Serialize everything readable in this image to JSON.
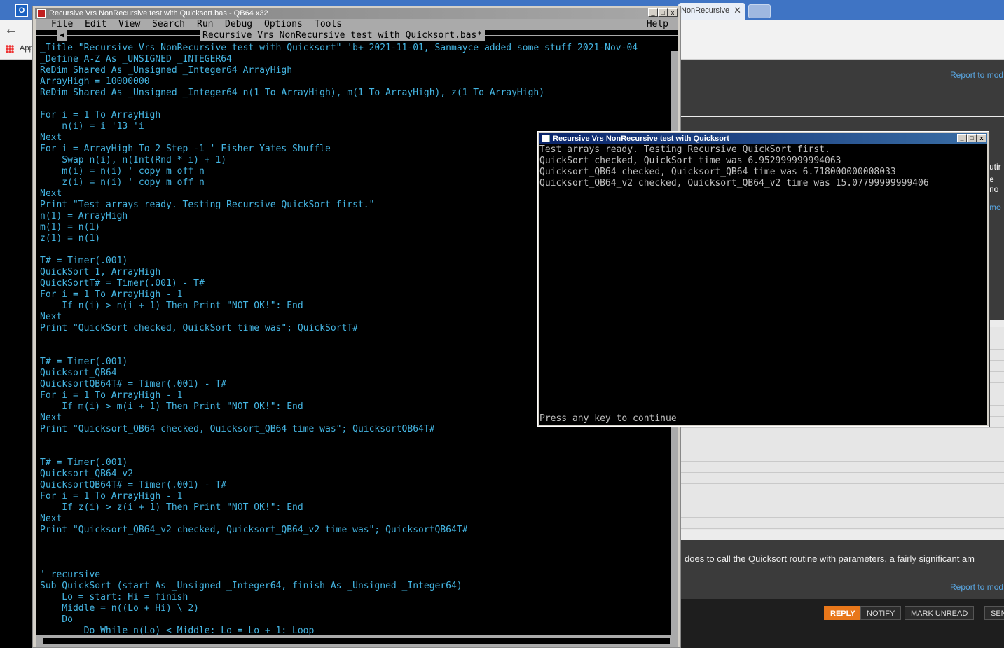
{
  "browser": {
    "tab_label": "NonRecursive",
    "close_glyph": "✕",
    "apps_label": "App",
    "back_glyph": "←",
    "outlook_glyph": "O",
    "page": {
      "report_label": "Report to mod",
      "post_text": "does to call the Quicksort routine with parameters, a fairly significant am",
      "stub1": "utir",
      "stub2": "e no",
      "stub3": "mo",
      "buttons": {
        "reply": "REPLY",
        "notify": "NOTIFY",
        "mark_unread": "MARK UNREAD",
        "send": "SEND T"
      }
    }
  },
  "ide": {
    "title": "Recursive Vrs NonRecursive test with Quicksort.bas - QB64 x32",
    "menu": [
      "File",
      "Edit",
      "View",
      "Search",
      "Run",
      "Debug",
      "Options",
      "Tools"
    ],
    "help_label": "Help",
    "file_title": "Recursive Vrs NonRecursive test with Quicksort.bas*",
    "code": [
      "_Title \"Recursive Vrs NonRecursive test with Quicksort\" 'b+ 2021-11-01, Sanmayce added some stuff 2021-Nov-04",
      "_Define A-Z As _UNSIGNED _INTEGER64",
      "ReDim Shared As _Unsigned _Integer64 ArrayHigh",
      "ArrayHigh = 10000000",
      "ReDim Shared As _Unsigned _Integer64 n(1 To ArrayHigh), m(1 To ArrayHigh), z(1 To ArrayHigh)",
      "",
      "For i = 1 To ArrayHigh",
      "    n(i) = i '13 'i",
      "Next",
      "For i = ArrayHigh To 2 Step -1 ' Fisher Yates Shuffle",
      "    Swap n(i), n(Int(Rnd * i) + 1)",
      "    m(i) = n(i) ' copy m off n",
      "    z(i) = n(i) ' copy m off n",
      "Next",
      "Print \"Test arrays ready. Testing Recursive QuickSort first.\"",
      "n(1) = ArrayHigh",
      "m(1) = n(1)",
      "z(1) = n(1)",
      "",
      "T# = Timer(.001)",
      "QuickSort 1, ArrayHigh",
      "QuickSortT# = Timer(.001) - T#",
      "For i = 1 To ArrayHigh - 1",
      "    If n(i) > n(i + 1) Then Print \"NOT OK!\": End",
      "Next",
      "Print \"QuickSort checked, QuickSort time was\"; QuickSortT#",
      "",
      "",
      "T# = Timer(.001)",
      "Quicksort_QB64",
      "QuicksortQB64T# = Timer(.001) - T#",
      "For i = 1 To ArrayHigh - 1",
      "    If m(i) > m(i + 1) Then Print \"NOT OK!\": End",
      "Next",
      "Print \"Quicksort_QB64 checked, Quicksort_QB64 time was\"; QuicksortQB64T#",
      "",
      "",
      "T# = Timer(.001)",
      "Quicksort_QB64_v2",
      "QuicksortQB64T# = Timer(.001) - T#",
      "For i = 1 To ArrayHigh - 1",
      "    If z(i) > z(i + 1) Then Print \"NOT OK!\": End",
      "Next",
      "Print \"Quicksort_QB64_v2 checked, Quicksort_QB64_v2 time was\"; QuicksortQB64T#",
      "",
      "",
      "",
      "' recursive",
      "Sub QuickSort (start As _Unsigned _Integer64, finish As _Unsigned _Integer64)",
      "    Lo = start: Hi = finish",
      "    Middle = n((Lo + Hi) \\ 2)",
      "    Do",
      "        Do While n(Lo) < Middle: Lo = Lo + 1: Loop"
    ]
  },
  "console": {
    "title": "Recursive Vrs NonRecursive test with Quicksort",
    "lines": [
      "Test arrays ready. Testing Recursive QuickSort first.",
      "QuickSort checked, QuickSort time was 6.952999999994063",
      "Quicksort_QB64 checked, Quicksort_QB64 time was 6.718000000008033",
      "Quicksort_QB64_v2 checked, Quicksort_QB64_v2 time was 15.07799999999406"
    ],
    "prompt": "Press any key to continue"
  }
}
